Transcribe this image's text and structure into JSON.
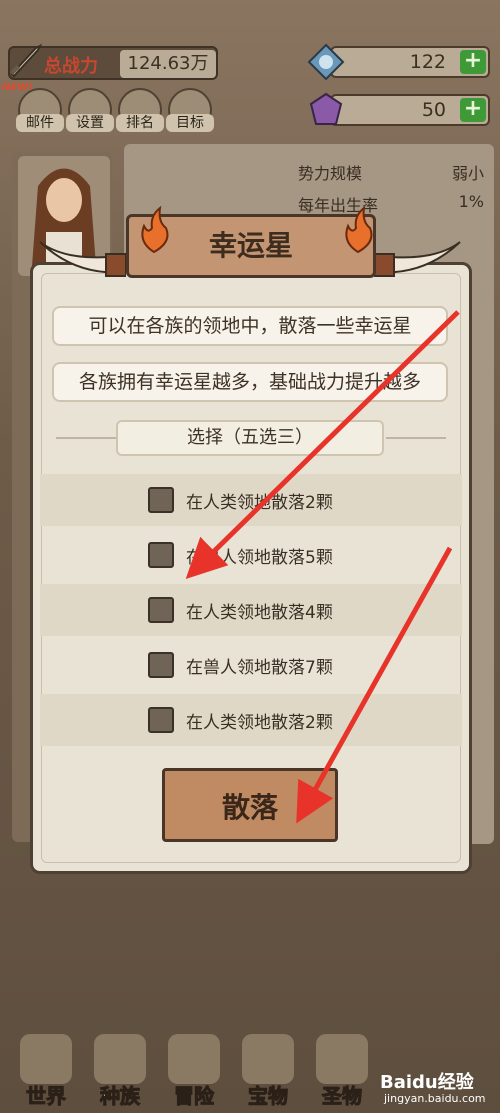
{
  "hud": {
    "power_label": "总战力",
    "power_value": "124.63万",
    "gems": "122",
    "crystals": "50",
    "plus": "+",
    "new_badge": "NEW!"
  },
  "menu": [
    "邮件",
    "设置",
    "排名",
    "目标"
  ],
  "stats": [
    {
      "label": "势力规模",
      "value": "弱小"
    },
    {
      "label": "每年出生率",
      "value": "1%"
    }
  ],
  "modal": {
    "title": "幸运星",
    "info1": "可以在各族的领地中，散落一些幸运星",
    "info2": "各族拥有幸运星越多，基础战力提升越多",
    "select_label": "选择（五选三）",
    "options": [
      "在人类领地散落2颗",
      "在兽人领地散落5颗",
      "在人类领地散落4颗",
      "在兽人领地散落7颗",
      "在人类领地散落2颗"
    ],
    "confirm": "散落"
  },
  "nav": [
    "世界",
    "种族",
    "冒险",
    "宝物",
    "圣物"
  ],
  "watermark": {
    "brand": "Baidu经验",
    "url": "jingyan.baidu.com"
  },
  "colors": {
    "accent_red": "#e8332a",
    "plus_green": "#3d9a36"
  }
}
